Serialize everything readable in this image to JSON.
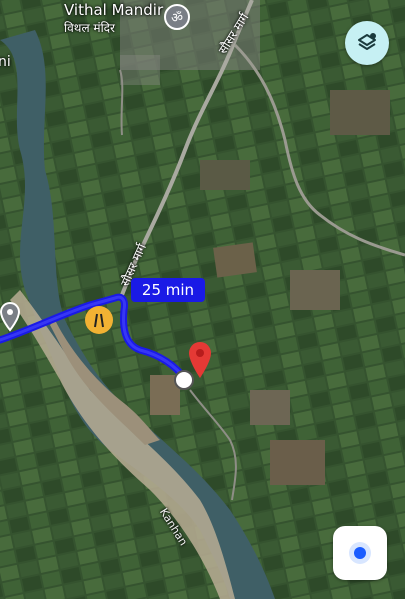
{
  "map": {
    "place_name": "Vithal Mandir",
    "place_name_hi": "विथल मंदिर",
    "edge_label": "ni",
    "road_label_top": "सौसर मार्ग",
    "road_label_mid": "सौसर मार्ग",
    "river_label": "Kanhan"
  },
  "route": {
    "eta": "25 min",
    "route_color": "#1a1ae6"
  },
  "controls": {
    "layers_icon": "layers-icon",
    "location_icon": "my-location-icon"
  },
  "colors": {
    "dest_pin": "#e53935",
    "layers_bg": "#c6f0f3"
  }
}
